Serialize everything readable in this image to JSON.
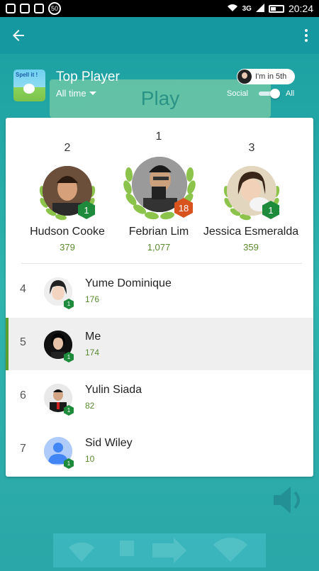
{
  "status_bar": {
    "left_badge": "50",
    "network": "3G",
    "time": "20:24"
  },
  "background": {
    "play_label": "Play"
  },
  "header": {
    "title": "Top Player",
    "period": "All time",
    "my_rank": "I'm in 5th",
    "toggle_left": "Social",
    "toggle_right": "All"
  },
  "game_icon": {
    "label": "Spell it !"
  },
  "podium": [
    {
      "rank": "2",
      "name": "Hudson Cooke",
      "score": "379",
      "level": "1"
    },
    {
      "rank": "1",
      "name": "Febrian Lim",
      "score": "1,077",
      "level": "18"
    },
    {
      "rank": "3",
      "name": "Jessica Esmeralda",
      "score": "359",
      "level": "1"
    }
  ],
  "leaderboard": [
    {
      "rank": "4",
      "name": "Yume Dominique",
      "score": "176",
      "level": "1"
    },
    {
      "rank": "5",
      "name": "Me",
      "score": "174",
      "level": "1"
    },
    {
      "rank": "6",
      "name": "Yulin Siada",
      "score": "82",
      "level": "1"
    },
    {
      "rank": "7",
      "name": "Sid Wiley",
      "score": "10",
      "level": "1"
    }
  ],
  "colors": {
    "accent_green": "#5a8a2e",
    "level_green": "#1e8a3c",
    "level_orange": "#d9531e",
    "teal": "#2aa7a8"
  },
  "icons": [
    "back-arrow-icon",
    "overflow-menu-icon",
    "caret-down-icon",
    "sound-icon",
    "wifi-icon"
  ]
}
